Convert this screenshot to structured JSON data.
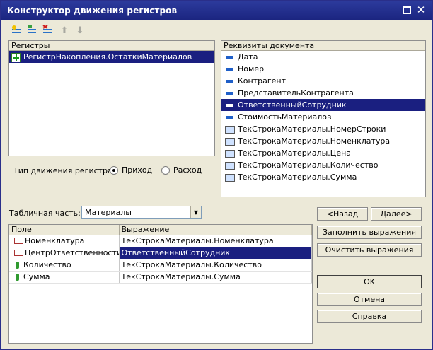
{
  "window": {
    "title": "Конструктор движения регистров"
  },
  "registers_panel": {
    "header": "Регистры",
    "items": [
      {
        "label": "РегистрНакопления.ОстаткиМатериалов",
        "selected": true
      }
    ]
  },
  "movement_type": {
    "label": "Тип движения регистра:",
    "options": [
      {
        "label": "Приход",
        "checked": true
      },
      {
        "label": "Расход",
        "checked": false
      }
    ]
  },
  "doc_attributes_panel": {
    "header": "Реквизиты документа",
    "items": [
      {
        "label": "Дата",
        "icon": "attribute-icon"
      },
      {
        "label": "Номер",
        "icon": "attribute-icon"
      },
      {
        "label": "Контрагент",
        "icon": "attribute-icon"
      },
      {
        "label": "ПредставительКонтрагента",
        "icon": "attribute-icon"
      },
      {
        "label": "ОтветственныйСотрудник",
        "icon": "attribute-icon",
        "selected": true
      },
      {
        "label": "СтоимостьМатериалов",
        "icon": "attribute-icon"
      },
      {
        "label": "ТекСтрокаМатериалы.НомерСтроки",
        "icon": "table-icon"
      },
      {
        "label": "ТекСтрокаМатериалы.Номенклатура",
        "icon": "table-icon"
      },
      {
        "label": "ТекСтрокаМатериалы.Цена",
        "icon": "table-icon"
      },
      {
        "label": "ТекСтрокаМатериалы.Количество",
        "icon": "table-icon"
      },
      {
        "label": "ТекСтрокаМатериалы.Сумма",
        "icon": "table-icon"
      }
    ]
  },
  "tabular_part": {
    "label": "Табличная часть:",
    "value": "Материалы"
  },
  "fields_table": {
    "columns": [
      "Поле",
      "Выражение"
    ],
    "rows": [
      {
        "field": "Номенклатура",
        "expression": "ТекСтрокаМатериалы.Номенклатура",
        "kind": "dimension"
      },
      {
        "field": "ЦентрОтветственности",
        "expression": "ОтветственныйСотрудник",
        "kind": "dimension",
        "selected": true
      },
      {
        "field": "Количество",
        "expression": "ТекСтрокаМатериалы.Количество",
        "kind": "resource"
      },
      {
        "field": "Сумма",
        "expression": "ТекСтрокаМатериалы.Сумма",
        "kind": "resource"
      }
    ]
  },
  "buttons": {
    "back": "<Назад",
    "next": "Далее>",
    "fill": "Заполнить выражения",
    "clear": "Очистить выражения",
    "ok": "OK",
    "cancel": "Отмена",
    "help": "Справка"
  }
}
